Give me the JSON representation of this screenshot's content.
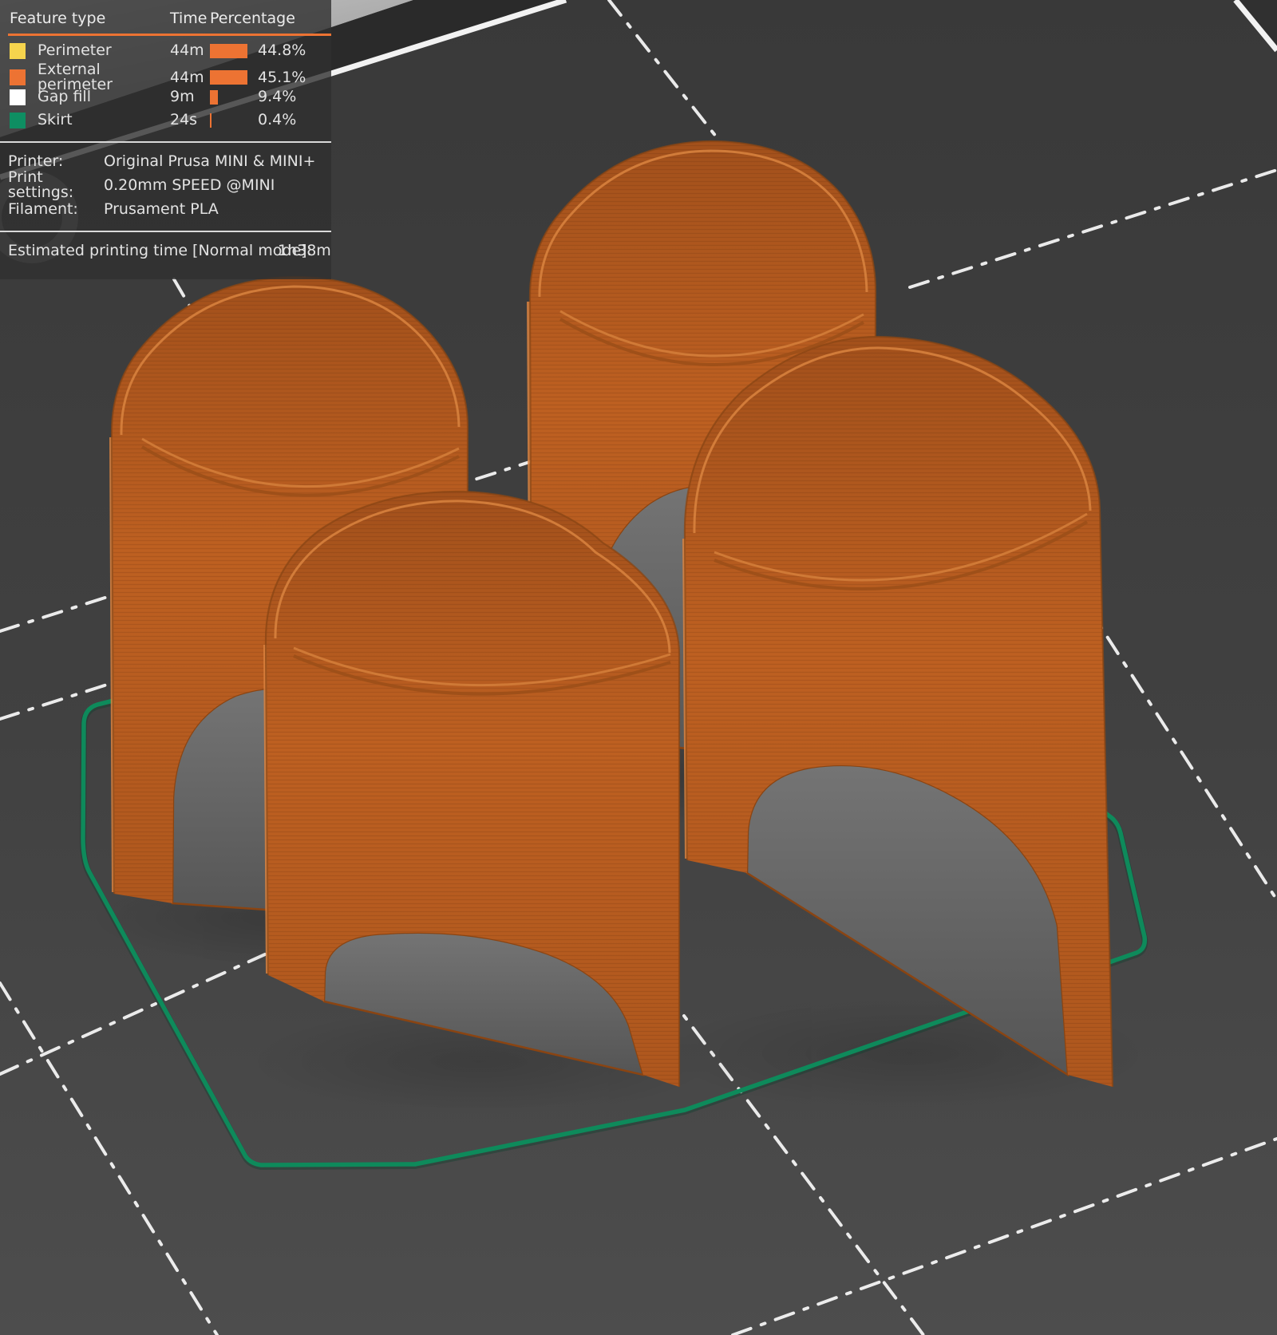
{
  "legend": {
    "columns": {
      "feature": "Feature type",
      "time": "Time",
      "percentage": "Percentage"
    },
    "rows": [
      {
        "swatch_color": "#F6D44D",
        "label": "Perimeter",
        "time": "44m",
        "pct": 44.8,
        "pct_label": "44.8%"
      },
      {
        "swatch_color": "#ED7333",
        "label": "External perimeter",
        "time": "44m",
        "pct": 45.1,
        "pct_label": "45.1%"
      },
      {
        "swatch_color": "#FFFFFF",
        "label": "Gap fill",
        "time": "9m",
        "pct": 9.4,
        "pct_label": "9.4%"
      },
      {
        "swatch_color": "#0E8E62",
        "label": "Skirt",
        "time": "24s",
        "pct": 0.4,
        "pct_label": "0.4%"
      }
    ],
    "info": [
      {
        "label": "Printer:",
        "value": "Original Prusa MINI & MINI+"
      },
      {
        "label": "Print settings:",
        "value": "0.20mm SPEED @MINI"
      },
      {
        "label": "Filament:",
        "value": "Prusament PLA"
      }
    ],
    "estimate": {
      "label": "Estimated printing time [Normal mode]:",
      "value": "1h38m"
    }
  },
  "scene": {
    "description": "G-code preview: four orange arched cylindrical shells with green skirt loop on dark build plate",
    "objects_count": 4,
    "plate_color": "#3f3f3f",
    "object_color": "#BE6021",
    "skirt_color": "#0E8A5B",
    "grid_line_color": "#FAFAFA",
    "accent_color": "#ED7333"
  }
}
